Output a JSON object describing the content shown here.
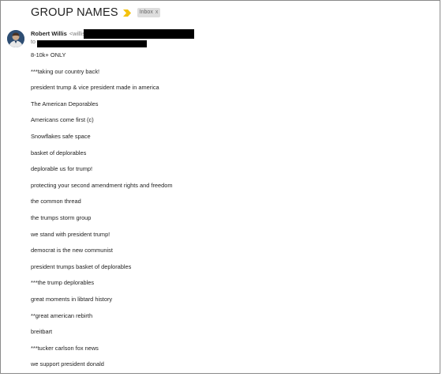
{
  "email": {
    "subject": "GROUP NAMES",
    "importance_icon": "importance-marker-icon",
    "label": {
      "text": "Inbox",
      "remove": "x"
    },
    "sender": {
      "name": "Robert Willis",
      "email_visible": "<willis"
    },
    "to_label": "to",
    "body": [
      "8-10k+ ONLY",
      "***taking our country back!",
      "president trump & vice president made in america",
      "The American Deporables",
      "Americans come first (c)",
      "Snowflakes safe space",
      "basket of deplorables",
      "deplorable us for trump!",
      "protecting your second amendment rights and freedom",
      "the common thread",
      "the trumps storm group",
      "we stand with president trump!",
      "democrat is the new communist",
      "president trumps basket of deplorables",
      "***the trump deplorables",
      "great moments in libtard history",
      "**great american rebirth",
      "breitbart",
      "***tucker carlson fox news",
      "we support president donald"
    ]
  },
  "colors": {
    "importance": "#f4c20d",
    "label_bg": "#dddddd",
    "redaction": "#000000"
  }
}
